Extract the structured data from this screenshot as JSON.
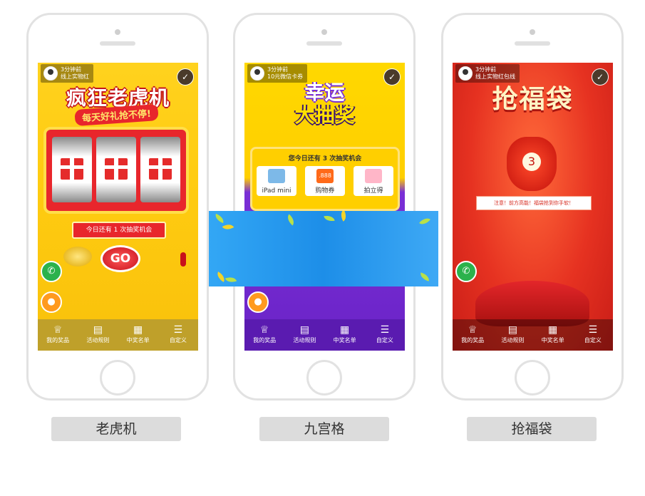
{
  "common_tabs": [
    {
      "icon": "trophy-icon",
      "label": "我的奖品"
    },
    {
      "icon": "document-icon",
      "label": "活动规则"
    },
    {
      "icon": "winners-list-icon",
      "label": "中奖名单"
    },
    {
      "icon": "grid-list-icon",
      "label": "自定义"
    }
  ],
  "slot": {
    "notice_time": "3分钟前",
    "notice_text": "线上实物红",
    "title": "疯狂老虎机",
    "subtitle": "每天好礼抢不停!",
    "count_text": "今日还有  1  次抽奖机会",
    "go_label": "GO",
    "caption": "老虎机"
  },
  "grid": {
    "notice_time": "3分钟前",
    "notice_text": "10元微信卡券",
    "title_line1": "幸运",
    "title_line2": "大抽奖",
    "count_text": "您今日还有  3  次抽奖机会",
    "cells": [
      "iPad mini",
      "购物券",
      "拍立得"
    ],
    "cell_888": ".888",
    "caption": "九宫格"
  },
  "bag": {
    "notice_time": "3分钟前",
    "notice_text": "线上实物红包线",
    "title": "抢福袋",
    "count": "3",
    "note": "注意！前方高能！福袋抢到你手软！",
    "caption": "抢福袋"
  },
  "colors": {
    "slot_bg": "#ffcc11",
    "grid_bg": "#6a23c7",
    "bag_bg": "#e63221",
    "banner": "#1d8ee8",
    "caption_bg": "#dcdcdc"
  }
}
